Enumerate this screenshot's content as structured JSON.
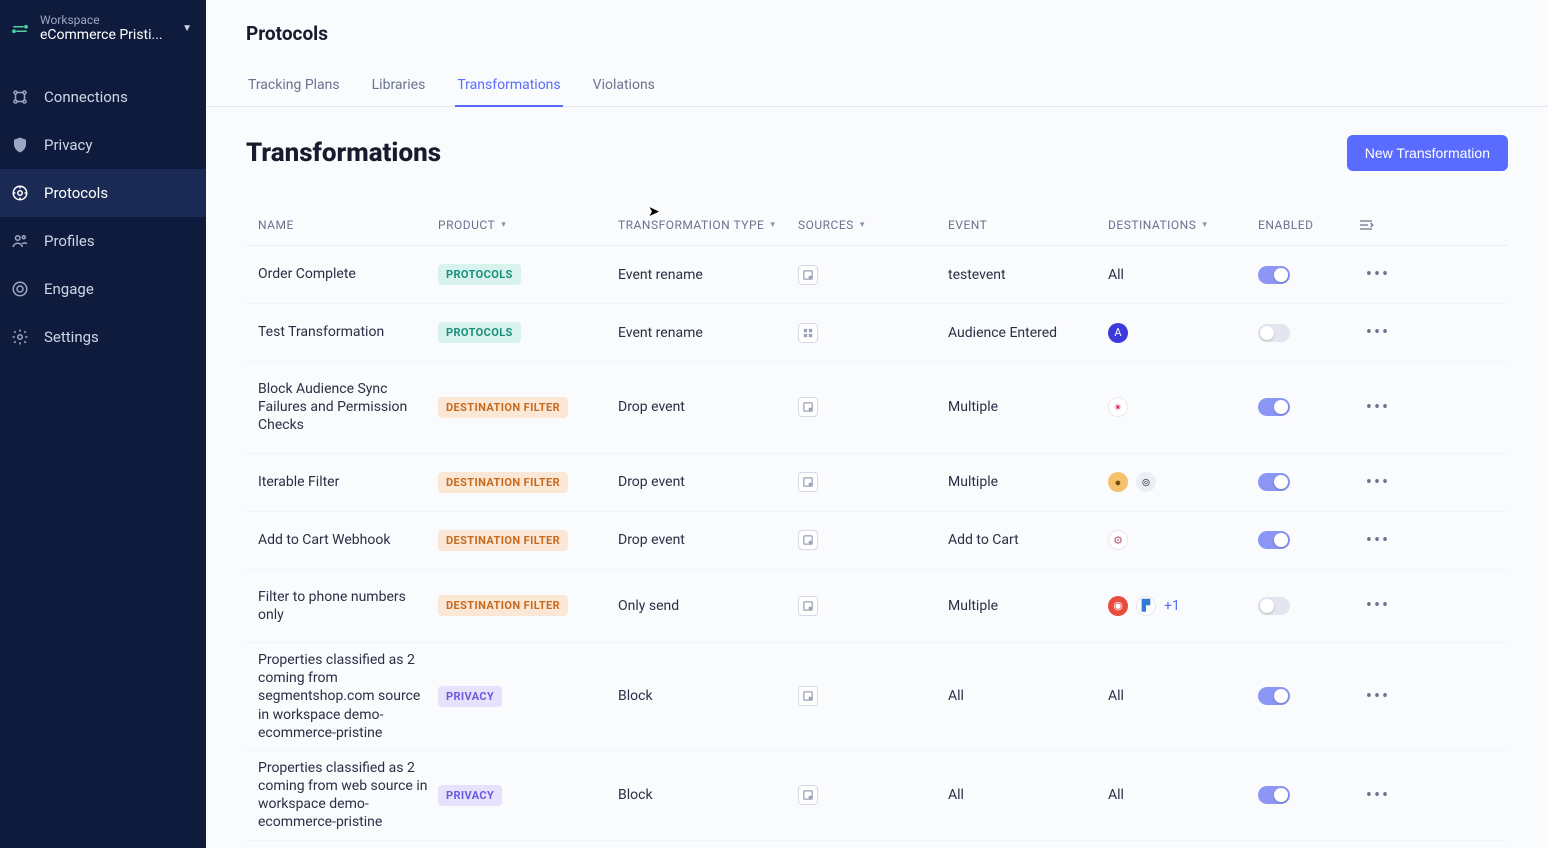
{
  "workspace": {
    "label": "Workspace",
    "name": "eCommerce Pristi..."
  },
  "sidebar": {
    "items": [
      {
        "label": "Connections",
        "icon": "connections"
      },
      {
        "label": "Privacy",
        "icon": "shield"
      },
      {
        "label": "Protocols",
        "icon": "protocols",
        "active": true
      },
      {
        "label": "Profiles",
        "icon": "profiles"
      },
      {
        "label": "Engage",
        "icon": "engage"
      },
      {
        "label": "Settings",
        "icon": "gear"
      }
    ]
  },
  "page": {
    "title": "Protocols",
    "tabs": [
      {
        "label": "Tracking Plans"
      },
      {
        "label": "Libraries"
      },
      {
        "label": "Transformations",
        "active": true
      },
      {
        "label": "Violations"
      }
    ],
    "section_title": "Transformations",
    "new_btn": "New Transformation"
  },
  "table": {
    "columns": {
      "name": "NAME",
      "product": "PRODUCT",
      "ttype": "TRANSFORMATION TYPE",
      "sources": "SOURCES",
      "event": "EVENT",
      "destinations": "DESTINATIONS",
      "enabled": "ENABLED"
    },
    "rows": [
      {
        "name": "Order Complete",
        "product": "PROTOCOLS",
        "product_class": "protocols",
        "ttype": "Event rename",
        "source_icon": "js",
        "event": "testevent",
        "destinations": {
          "text": "All"
        },
        "enabled": true
      },
      {
        "name": "Test Transformation",
        "product": "PROTOCOLS",
        "product_class": "protocols",
        "ttype": "Event rename",
        "source_icon": "grid",
        "event": "Audience Entered",
        "destinations": {
          "dots": [
            {
              "bg": "#3b3bdc",
              "char": "A"
            }
          ]
        },
        "enabled": false
      },
      {
        "name": "Block Audience Sync Failures and Permission Checks",
        "product": "DESTINATION FILTER",
        "product_class": "dest",
        "ttype": "Drop event",
        "source_icon": "js",
        "event": "Multiple",
        "destinations": {
          "dots": [
            {
              "bg": "#ffffff",
              "char": "✴",
              "fg": "#e01e5a",
              "border": "#e6e9f2"
            }
          ]
        },
        "enabled": true
      },
      {
        "name": "Iterable Filter",
        "product": "DESTINATION FILTER",
        "product_class": "dest",
        "ttype": "Drop event",
        "source_icon": "js",
        "event": "Multiple",
        "destinations": {
          "dots": [
            {
              "bg": "#f5c26b",
              "char": "●",
              "fg": "#7a4a10"
            },
            {
              "bg": "#eceef5",
              "char": "⊚",
              "fg": "#555"
            }
          ]
        },
        "enabled": true
      },
      {
        "name": "Add to Cart Webhook",
        "product": "DESTINATION FILTER",
        "product_class": "dest",
        "ttype": "Drop event",
        "source_icon": "js",
        "event": "Add to Cart",
        "destinations": {
          "dots": [
            {
              "bg": "#ffffff",
              "char": "⚙",
              "fg": "#b85c7d",
              "border": "#e6e9f2"
            }
          ]
        },
        "enabled": true
      },
      {
        "name": "Filter to phone numbers only",
        "product": "DESTINATION FILTER",
        "product_class": "dest",
        "ttype": "Only send",
        "source_icon": "js",
        "event": "Multiple",
        "destinations": {
          "dots": [
            {
              "bg": "#e84c3d",
              "char": "◉",
              "fg": "#fff"
            },
            {
              "bg": "#ffffff",
              "char": "▛",
              "fg": "#2f7bd8",
              "border": "#e6e9f2"
            }
          ],
          "more": "+1"
        },
        "enabled": false
      },
      {
        "name": "Properties classified as 2 coming from segmentshop.com source in workspace demo-ecommerce-pristine",
        "product": "PRIVACY",
        "product_class": "privacy",
        "ttype": "Block",
        "source_icon": "js",
        "event": "All",
        "destinations": {
          "text": "All"
        },
        "enabled": true,
        "tight": true
      },
      {
        "name": "Properties classified as 2 coming from web source in workspace demo-ecommerce-pristine",
        "product": "PRIVACY",
        "product_class": "privacy",
        "ttype": "Block",
        "source_icon": "js",
        "event": "All",
        "destinations": {
          "text": "All"
        },
        "enabled": true,
        "tight": true
      }
    ]
  }
}
